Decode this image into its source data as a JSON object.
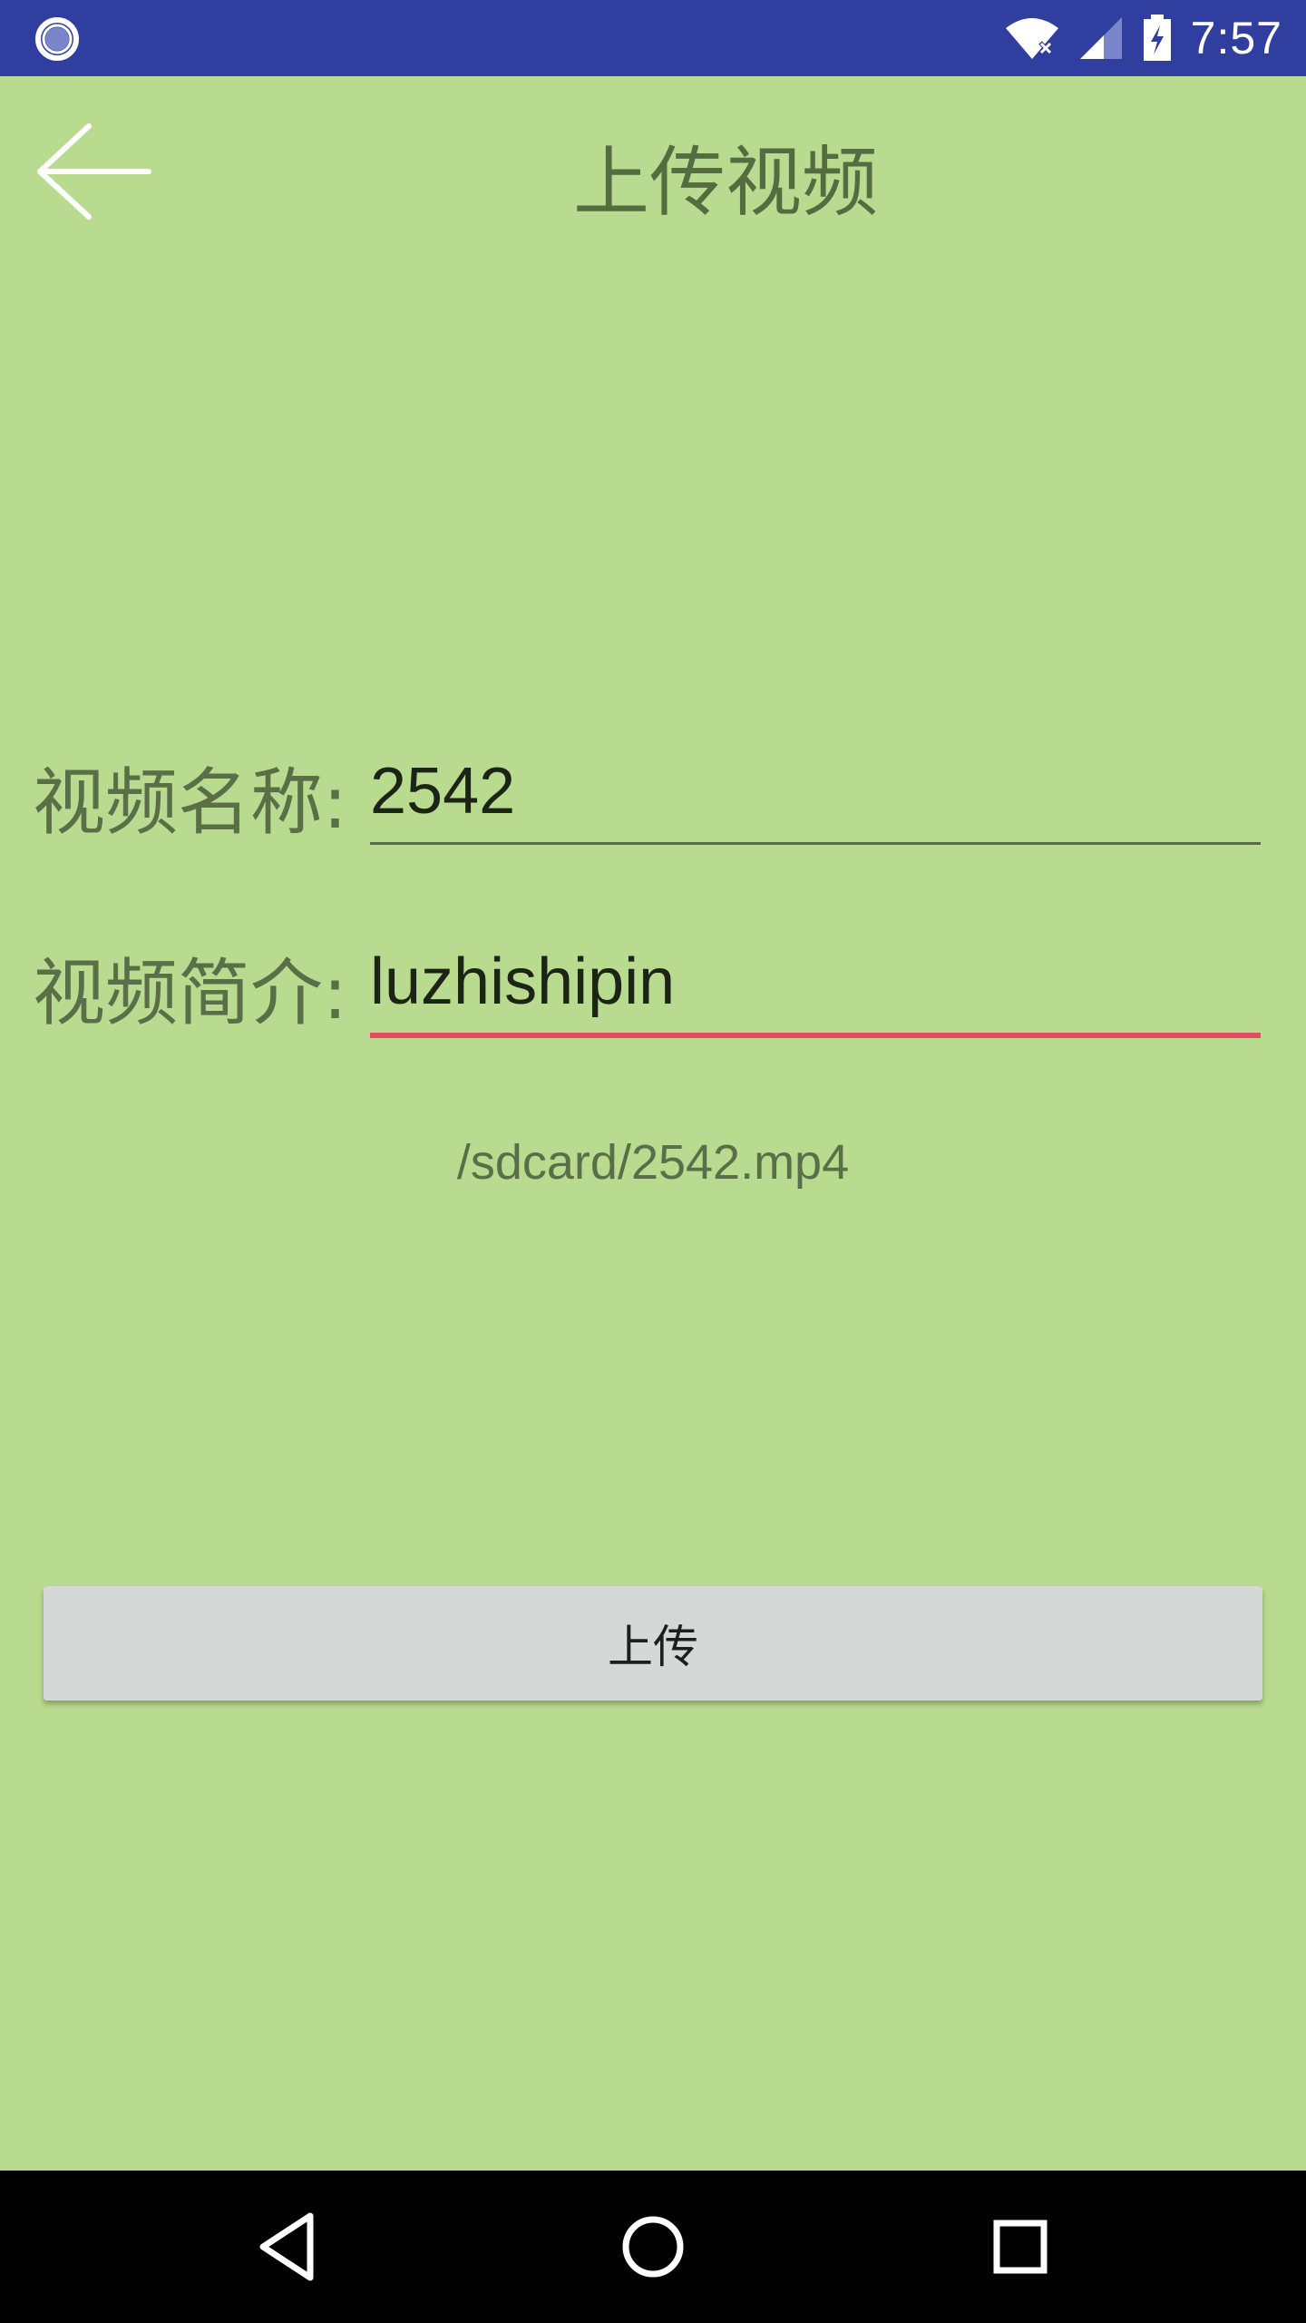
{
  "status_bar": {
    "time": "7:57",
    "icons": [
      "notification-dot-icon",
      "wifi-icon",
      "cell-signal-icon",
      "battery-charging-icon"
    ]
  },
  "app_bar": {
    "title": "上传视频",
    "back_icon": "arrow-back-icon"
  },
  "form": {
    "video_name_label": "视频名称:",
    "video_name_value": "2542",
    "video_desc_label": "视频简介:",
    "video_desc_value": "luzhishipin",
    "file_path": "/sdcard/2542.mp4"
  },
  "actions": {
    "upload_label": "上传"
  },
  "nav_bar": {
    "icons": [
      "nav-back-icon",
      "nav-home-icon",
      "nav-recents-icon"
    ]
  },
  "colors": {
    "background": "#b9db8f",
    "status_bar": "#303f9f",
    "focused_underline": "#e84a64",
    "underline": "#556b40",
    "button": "#d6d7d7"
  }
}
